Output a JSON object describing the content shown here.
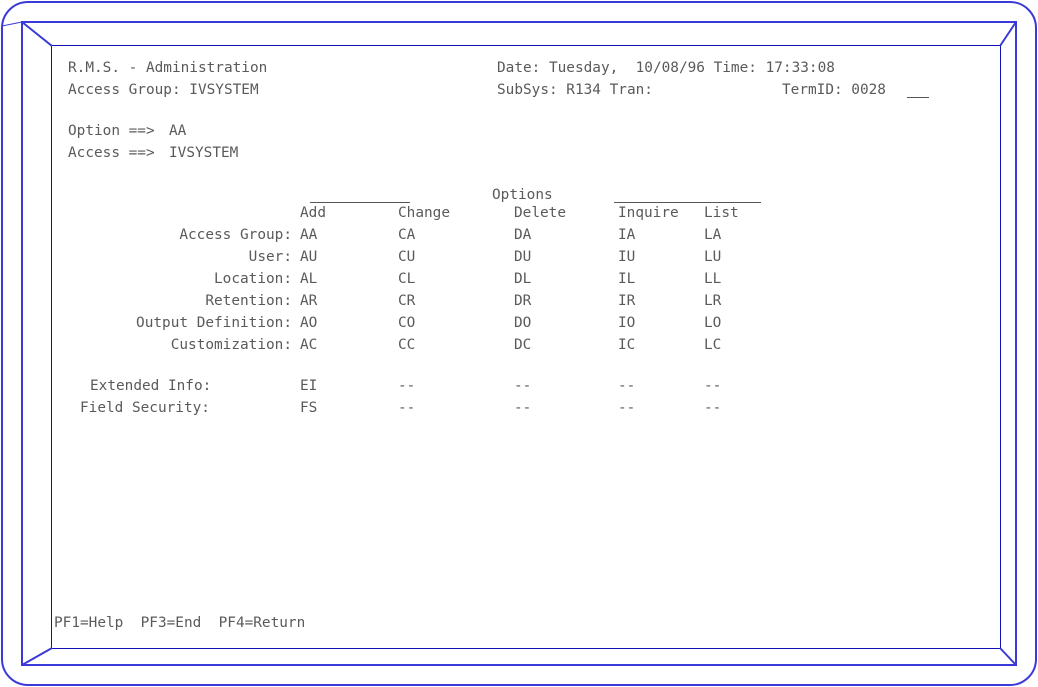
{
  "header": {
    "app_title": "R.M.S. - Administration",
    "access_group": "Access Group: IVSYSTEM",
    "date_time": "Date: Tuesday,  10/08/96 Time: 17:33:08",
    "subsys": "SubSys: R134 Tran:",
    "termid": "TermID: 0028"
  },
  "inputs": {
    "option_label": "Option ==>",
    "option_value": "AA",
    "access_label": "Access ==>",
    "access_value": "IVSYSTEM"
  },
  "options_grid": {
    "title": "Options",
    "columns": [
      "Add",
      "Change",
      "Delete",
      "Inquire",
      "List"
    ],
    "rows": [
      {
        "label": "Access Group:",
        "codes": [
          "AA",
          "CA",
          "DA",
          "IA",
          "LA"
        ]
      },
      {
        "label": "User:",
        "codes": [
          "AU",
          "CU",
          "DU",
          "IU",
          "LU"
        ]
      },
      {
        "label": "Location:",
        "codes": [
          "AL",
          "CL",
          "DL",
          "IL",
          "LL"
        ]
      },
      {
        "label": "Retention:",
        "codes": [
          "AR",
          "CR",
          "DR",
          "IR",
          "LR"
        ]
      },
      {
        "label": "Output Definition:",
        "codes": [
          "AO",
          "CO",
          "DO",
          "IO",
          "LO"
        ]
      },
      {
        "label": "Customization:",
        "codes": [
          "AC",
          "CC",
          "DC",
          "IC",
          "LC"
        ]
      }
    ],
    "extra_rows": [
      {
        "label": "Extended Info:",
        "codes": [
          "EI",
          "--",
          "--",
          "--",
          "--"
        ]
      },
      {
        "label": "Field Security:",
        "codes": [
          "FS",
          "--",
          "--",
          "--",
          "--"
        ]
      }
    ]
  },
  "footer": {
    "pf_keys": "PF1=Help  PF3=End  PF4=Return"
  },
  "colors": {
    "bezel_outer": "#2b2bd6",
    "bezel_inner": "#1a1ac0",
    "text": "#5a5a5a"
  }
}
